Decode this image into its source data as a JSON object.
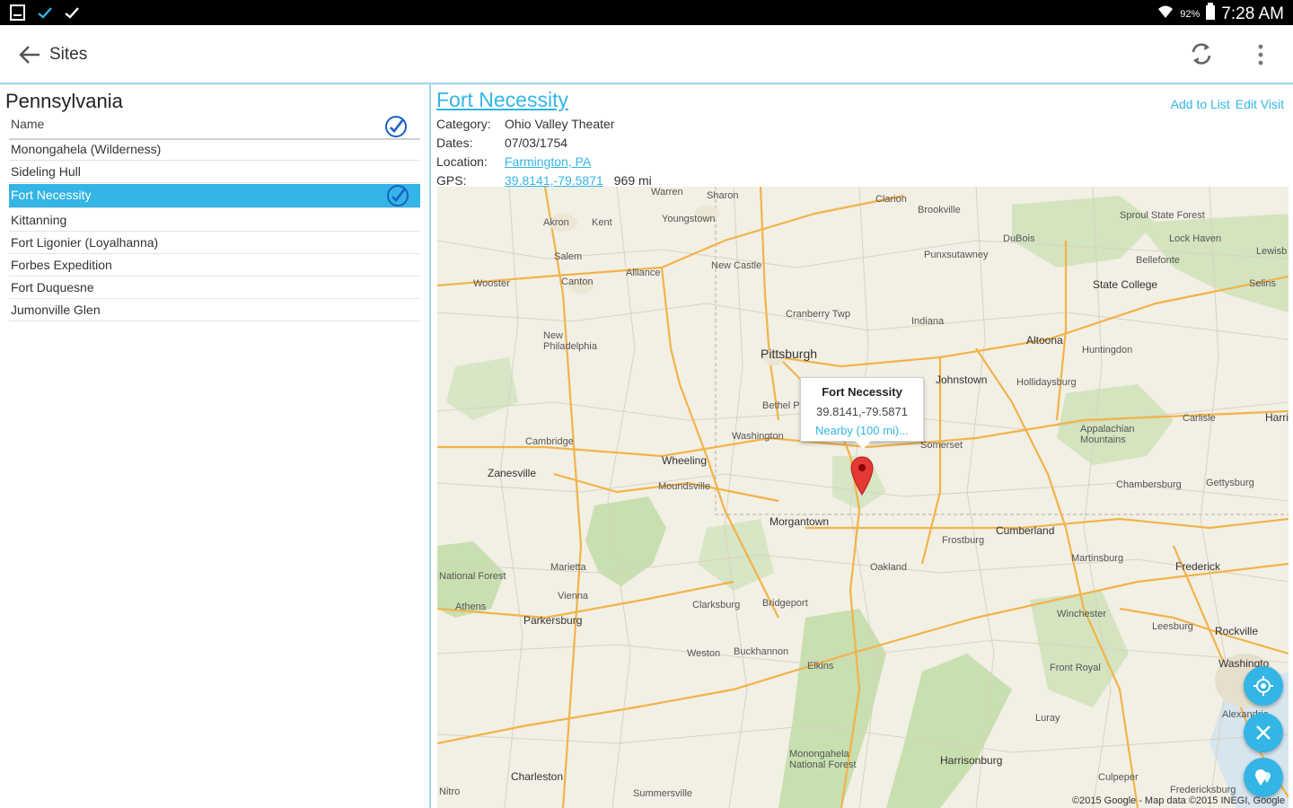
{
  "status_bar": {
    "battery": "92%",
    "time": "7:28 AM"
  },
  "toolbar": {
    "title": "Sites"
  },
  "left_panel": {
    "state": "Pennsylvania",
    "column_header": "Name",
    "sites": [
      {
        "name": "Monongahela (Wilderness)",
        "checked": false,
        "selected": false
      },
      {
        "name": "Sideling Hull",
        "checked": false,
        "selected": false
      },
      {
        "name": "Fort Necessity",
        "checked": true,
        "selected": true
      },
      {
        "name": "Kittanning",
        "checked": false,
        "selected": false
      },
      {
        "name": "Fort Ligonier (Loyalhanna)",
        "checked": false,
        "selected": false
      },
      {
        "name": "Forbes Expedition",
        "checked": false,
        "selected": false
      },
      {
        "name": "Fort Duquesne",
        "checked": false,
        "selected": false
      },
      {
        "name": "Jumonville Glen",
        "checked": false,
        "selected": false
      }
    ]
  },
  "detail": {
    "title": "Fort Necessity",
    "add_to_list": "Add to List",
    "edit_visit": "Edit Visit",
    "category_label": "Category:",
    "category": "Ohio Valley Theater",
    "dates_label": "Dates:",
    "dates": "07/03/1754",
    "location_label": "Location:",
    "location": "Farmington, PA",
    "gps_label": "GPS:",
    "gps": "39.8141,-79.5871",
    "distance": "969 mi"
  },
  "map": {
    "callout_title": "Fort Necessity",
    "callout_coords": "39.8141,-79.5871",
    "callout_link": "Nearby (100 mi)...",
    "copyright": "©2015 Google - Map data ©2015 INEGI, Google",
    "labels": {
      "pittsburgh": "Pittsburgh",
      "youngstown": "Youngstown",
      "new_castle": "New Castle",
      "canton": "Canton",
      "akron": "Akron",
      "kent": "Kent",
      "alliance": "Alliance",
      "wooster": "Wooster",
      "salem": "Salem",
      "warren": "Warren",
      "sharon": "Sharon",
      "clarion": "Clarion",
      "brookville": "Brookville",
      "sproul": "Sproul State Forest",
      "dubois": "DuBois",
      "punxsutawney": "Punxsutawney",
      "lock_haven": "Lock Haven",
      "bellefonte": "Bellefonte",
      "state_college": "State College",
      "lewisburg": "Lewisb",
      "selins": "Selins",
      "cranberry": "Cranberry Twp",
      "indiana": "Indiana",
      "altoona": "Altoona",
      "huntingdon": "Huntingdon",
      "johnstown": "Johnstown",
      "hollidaysburg": "Hollidaysburg",
      "new_philadelphia": "New Philadelphia",
      "bethel_park": "Bethel Park",
      "washington": "Washington",
      "somerset": "Somerset",
      "carlisle": "Carlisle",
      "harrisburg": "Harris",
      "appalachian": "Appalachian Mountains",
      "chambersburg": "Chambersburg",
      "gettysburg": "Gettysburg",
      "cambridge": "Cambridge",
      "zanesville": "Zanesville",
      "wheeling": "Wheeling",
      "moundsville": "Moundsville",
      "morgantown": "Morgantown",
      "frostburg": "Frostburg",
      "cumberland": "Cumberland",
      "martinsburg": "Martinsburg",
      "frederick": "Frederick",
      "national_forest": "National Forest",
      "marietta": "Marietta",
      "vienna": "Vienna",
      "oakland": "Oakland",
      "athens": "Athens",
      "parkersburg": "Parkersburg",
      "clarksburg": "Clarksburg",
      "bridgeport": "Bridgeport",
      "winchester": "Winchester",
      "leesburg": "Leesburg",
      "rockville": "Rockville",
      "weston": "Weston",
      "buckhannon": "Buckhannon",
      "elkins": "Elkins",
      "front_royal": "Front Royal",
      "washington_dc": "Washingto",
      "alexandria": "Alexandria",
      "luray": "Luray",
      "monongahela_nf": "Monongahela National Forest",
      "harrisonburg": "Harrisonburg",
      "culpeper": "Culpeper",
      "fredericksburg": "Fredericksburg",
      "charleston": "Charleston",
      "summersville": "Summersville",
      "nitro": "Nitro"
    }
  }
}
